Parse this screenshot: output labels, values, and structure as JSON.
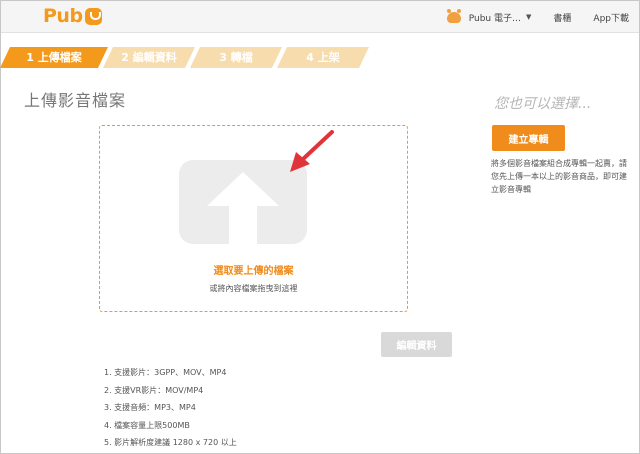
{
  "header": {
    "logo_text": "Pub",
    "user_label": "Pubu 電子…",
    "links": [
      "書櫃",
      "App下載"
    ]
  },
  "steps": [
    {
      "label": "1 上傳檔案",
      "active": true
    },
    {
      "label": "2 編輯資料",
      "active": false
    },
    {
      "label": "3 轉檔",
      "active": false
    },
    {
      "label": "4 上架",
      "active": false
    }
  ],
  "main": {
    "title": "上傳影音檔案",
    "dropzone": {
      "select_label": "選取要上傳的檔案",
      "drag_hint": "或將內容檔案拖曳到這裡"
    },
    "edit_button": "編輯資料",
    "notes": [
      "1. 支援影片：3GPP、MOV、MP4",
      "2. 支援VR影片：MOV/MP4",
      "3. 支援音頻：MP3、MP4",
      "4. 檔案容量上限500MB",
      "5. 影片解析度建議 1280 x 720 以上"
    ]
  },
  "sidebar": {
    "title": "您也可以選擇...",
    "create_button": "建立專輯",
    "description": "將多個影音檔案組合成專輯一起賣，請您先上傳一本以上的影音商品，即可建立影音專輯"
  },
  "colors": {
    "accent": "#f39a1c",
    "step_inactive": "#f7dcae",
    "button_disabled": "#d9d9d9"
  }
}
